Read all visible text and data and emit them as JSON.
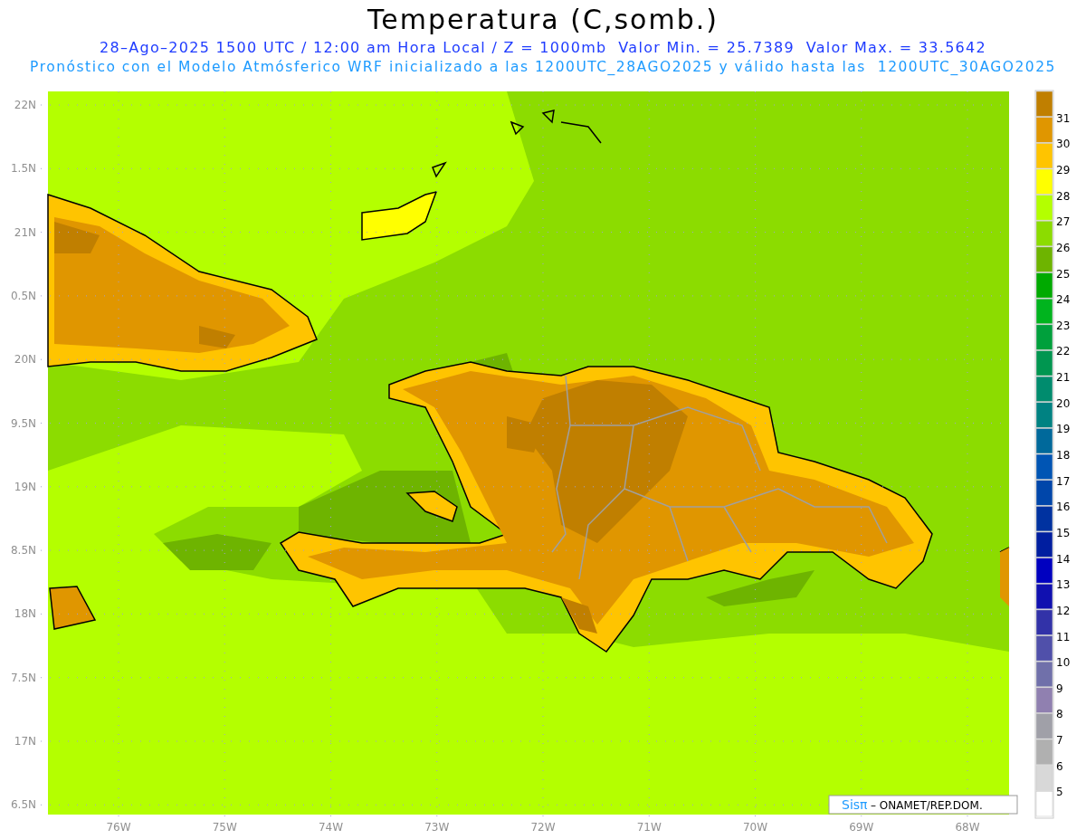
{
  "title": "Temperatura (C,somb.)",
  "subtitle": "28–Ago–2025 1500 UTC / 12:00 am Hora Local / Z = 1000mb  Valor Min. = 25.7389  Valor Max. = 33.5642",
  "description": "Pronóstico con el Modelo Atmósferico WRF inicializado a las 1200UTC_28AGO2025 y válido hasta las  1200UTC_30AGO2025",
  "lat_ticks": [
    "22N",
    "1.5N",
    "21N",
    "0.5N",
    "20N",
    "9.5N",
    "19N",
    "8.5N",
    "18N",
    "7.5N",
    "17N",
    "6.5N"
  ],
  "lon_ticks": [
    "76W",
    "75W",
    "74W",
    "73W",
    "72W",
    "71W",
    "70W",
    "69W",
    "68W"
  ],
  "colorbar": {
    "swatches": [
      {
        "color": "#c07f00"
      },
      {
        "color": "#e09600"
      },
      {
        "color": "#ffc400"
      },
      {
        "color": "#ffff00"
      },
      {
        "color": "#b4ff00"
      },
      {
        "color": "#8cdc00"
      },
      {
        "color": "#6eb400"
      },
      {
        "color": "#00aa00"
      },
      {
        "color": "#00b41e"
      },
      {
        "color": "#00a03c"
      },
      {
        "color": "#009650"
      },
      {
        "color": "#008c6e"
      },
      {
        "color": "#008282"
      },
      {
        "color": "#00699b"
      },
      {
        "color": "#0055b4"
      },
      {
        "color": "#0046aa"
      },
      {
        "color": "#0032a0"
      },
      {
        "color": "#001ea0"
      },
      {
        "color": "#0000c0"
      },
      {
        "color": "#1010b0"
      },
      {
        "color": "#3232a8"
      },
      {
        "color": "#5050aa"
      },
      {
        "color": "#7070aa"
      },
      {
        "color": "#9080b0"
      },
      {
        "color": "#a0a0a8"
      },
      {
        "color": "#b0b0b0"
      },
      {
        "color": "#d8d8d8"
      },
      {
        "color": "#ffffff"
      }
    ],
    "labels": [
      "31",
      "30",
      "29",
      "28",
      "27",
      "26",
      "25",
      "24",
      "23",
      "22",
      "21",
      "20",
      "19",
      "18",
      "17",
      "16",
      "15",
      "14",
      "13",
      "12",
      "11",
      "10",
      "9",
      "8",
      "7",
      "6",
      "5"
    ]
  },
  "credit": {
    "logo": "Sisπ",
    "text": "– ONAMET/REP.DOM."
  }
}
